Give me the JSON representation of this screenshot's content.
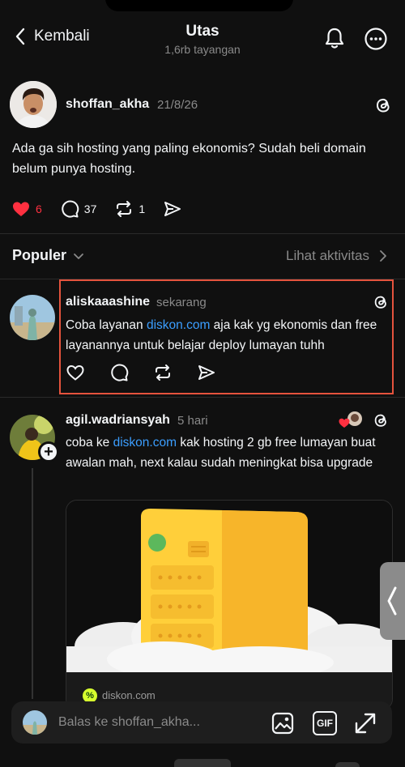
{
  "header": {
    "back_label": "Kembali",
    "title": "Utas",
    "views": "1,6rb tayangan"
  },
  "post": {
    "username": "shoffan_akha",
    "date": "21/8/26",
    "text": "Ada ga sih hosting yang paling ekonomis? Sudah beli domain belum punya hosting.",
    "likes": "6",
    "comments": "37",
    "reposts": "1",
    "liked": true
  },
  "sort": {
    "label": "Populer",
    "activity_label": "Lihat aktivitas"
  },
  "replies": [
    {
      "username": "aliskaaashine",
      "time": "sekarang",
      "text_before": "Coba layanan ",
      "link": "diskon.com",
      "text_after": " aja kak yg ekonomis dan free layanannya untuk belajar deploy lumayan tuhh"
    },
    {
      "username": "agil.wadriansyah",
      "time": "5 hari",
      "text_before": "coba ke ",
      "link": "diskon.com",
      "text_after": " kak hosting 2 gb free lumayan buat awalan mah, next kalau sudah meningkat bisa upgrade",
      "preview_domain": "diskon.com",
      "preview_badge": "%"
    }
  ],
  "reply_bar": {
    "placeholder": "Balas ke shoffan_akha...",
    "gif_label": "GIF"
  },
  "colors": {
    "background": "#101010",
    "like": "#ff3040",
    "link": "#3b9eff",
    "highlight": "#e5533d",
    "server": "#ffd23a"
  },
  "icons": [
    "chevron-left-icon",
    "bell-icon",
    "more-icon",
    "threads-icon",
    "heart-icon",
    "comment-icon",
    "repost-icon",
    "share-icon",
    "chevron-down-icon",
    "chevron-right-icon",
    "image-icon",
    "gif-icon",
    "expand-icon"
  ]
}
